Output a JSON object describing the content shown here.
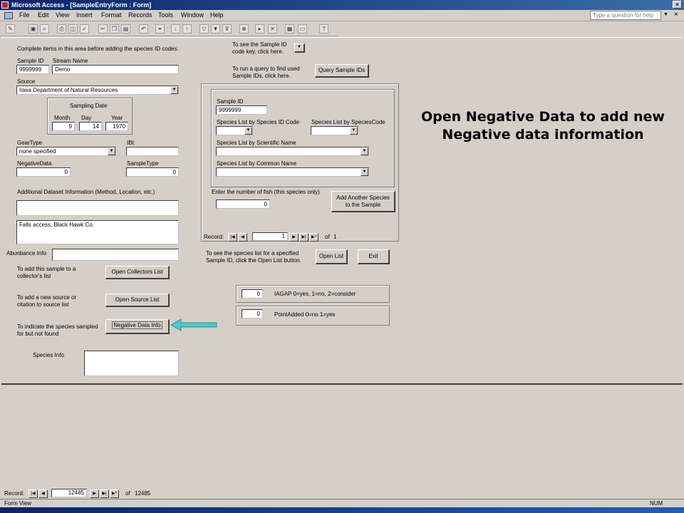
{
  "window": {
    "title": "Microsoft Access - [SampleEntryForm : Form]"
  },
  "menu": [
    "File",
    "Edit",
    "View",
    "Insert",
    "Format",
    "Records",
    "Tools",
    "Window",
    "Help"
  ],
  "help_placeholder": "Type a question for help",
  "form": {
    "intro": "Complete items in this area before adding the species ID codes.",
    "sample_id_label": "Sample ID",
    "sample_id": "9999999",
    "stream_name_label": "Stream Name",
    "stream_name": "Demo",
    "source_label": "Source",
    "source": "Iowa Department of Natural Resources",
    "sampling_date_label": "Sampling Date",
    "month_label": "Month",
    "month": "9",
    "day_label": "Day",
    "day": "14",
    "year_label": "Year",
    "year": "1970",
    "geartype_label": "GearType",
    "geartype": "none specified",
    "ibi_label": "IBI:",
    "negativedata_label": "NegativeData",
    "negativedata": "0",
    "sampletype_label": "SampleType",
    "sampletype": "0",
    "additional_label": "Additional Dataset Information (Method, Location, etc.)",
    "location_text": "Falls access, Black Hawk Co.",
    "abundance_label": "Abunbance Info",
    "collectors_text": "To add this sample to a collector's list",
    "collectors_button": "Open Collectors List",
    "source_text": "To add a new source or citation to source list",
    "source_button": "Open Source List",
    "negative_text": "To indicate the species sampled for but not found",
    "negative_button": "Negative Data Info",
    "species_info_label": "Species Info"
  },
  "right": {
    "species_key_text": "To see the Sample ID code key, click here.",
    "query_text": "To run a query to find used Sample IDs, click here.",
    "query_button": "Query Sample IDs",
    "sub_sample_id_label": "Sample ID",
    "sub_sample_id": "9999999",
    "by_id_code_label": "Species List by Species ID Code",
    "by_species_code_label": "Species List by SpeciesCode",
    "by_scientific_label": "Species List by Scientific Name",
    "by_common_label": "Species List by Common Name",
    "fish_count_label": "Enter the number of fish (this species only)",
    "fish_count": "0",
    "add_species_button": "Add Another Species to the Sample",
    "record_label": "Record:",
    "record_current": "1",
    "record_of": "of",
    "record_total": "1",
    "open_list_text": "To see the species list for a specified Sample ID, click the Open List button.",
    "open_list_button": "Open List",
    "exit_button": "Exit",
    "iagap_value": "0",
    "iagap_label": "IAGAP  0=yes, 1=no, 2=consider",
    "pointadded_value": "0",
    "pointadded_label": "PointAdded 0=no 1=yes"
  },
  "bottom": {
    "record_label": "Record:",
    "record_current": "12485",
    "record_of": "of",
    "record_total": "12485",
    "status_left": "Form View",
    "status_right": "NUM"
  },
  "annotation": {
    "line1": "Open Negative Data to add new",
    "line2": "Negative data information"
  },
  "colors": {
    "arrow": "#4fc8c8",
    "titlebar": "#0a246a"
  }
}
